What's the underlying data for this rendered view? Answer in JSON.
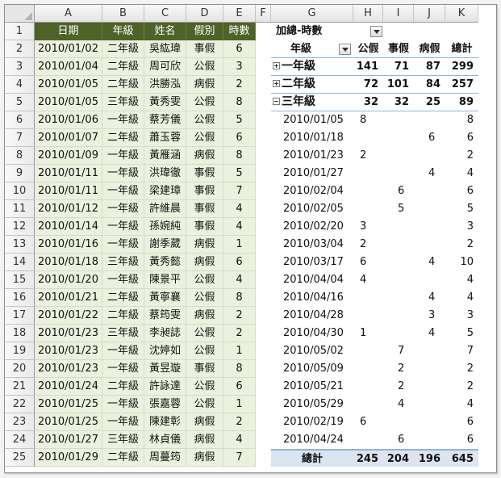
{
  "columns": [
    "A",
    "B",
    "C",
    "D",
    "E",
    "F",
    "G",
    "H",
    "I",
    "J",
    "K"
  ],
  "row_numbers": [
    "1",
    "2",
    "3",
    "4",
    "5",
    "6",
    "7",
    "8",
    "9",
    "10",
    "11",
    "12",
    "13",
    "14",
    "15",
    "16",
    "17",
    "18",
    "19",
    "20",
    "21",
    "22",
    "23",
    "24",
    "25"
  ],
  "source_table": {
    "headers": [
      "日期",
      "年級",
      "姓名",
      "假別",
      "時數"
    ],
    "rows": [
      [
        "2010/01/02",
        "二年級",
        "吳紘瑋",
        "事假",
        "6"
      ],
      [
        "2010/01/04",
        "二年級",
        "周可欣",
        "公假",
        "3"
      ],
      [
        "2010/01/05",
        "二年級",
        "洪勝泓",
        "病假",
        "2"
      ],
      [
        "2010/01/05",
        "三年級",
        "黃秀雯",
        "公假",
        "8"
      ],
      [
        "2010/01/06",
        "一年級",
        "蔡芳儀",
        "公假",
        "5"
      ],
      [
        "2010/01/07",
        "二年級",
        "蕭玉蓉",
        "公假",
        "6"
      ],
      [
        "2010/01/09",
        "一年級",
        "黃雁涵",
        "病假",
        "8"
      ],
      [
        "2010/01/11",
        "一年級",
        "洪瑋徹",
        "事假",
        "5"
      ],
      [
        "2010/01/11",
        "一年級",
        "梁建璋",
        "事假",
        "7"
      ],
      [
        "2010/01/12",
        "一年級",
        "許維晨",
        "事假",
        "4"
      ],
      [
        "2010/01/14",
        "一年級",
        "孫婉純",
        "事假",
        "4"
      ],
      [
        "2010/01/16",
        "一年級",
        "謝季葳",
        "病假",
        "1"
      ],
      [
        "2010/01/18",
        "三年級",
        "黃秀懿",
        "病假",
        "6"
      ],
      [
        "2010/01/20",
        "一年級",
        "陳景平",
        "公假",
        "4"
      ],
      [
        "2010/01/21",
        "二年級",
        "黃寧襄",
        "公假",
        "8"
      ],
      [
        "2010/01/22",
        "二年級",
        "蔡筠雯",
        "病假",
        "2"
      ],
      [
        "2010/01/23",
        "三年級",
        "李昶誌",
        "公假",
        "2"
      ],
      [
        "2010/01/23",
        "一年級",
        "沈婷如",
        "公假",
        "1"
      ],
      [
        "2010/01/23",
        "一年級",
        "黃昱璇",
        "事假",
        "8"
      ],
      [
        "2010/01/24",
        "二年級",
        "許詠達",
        "公假",
        "6"
      ],
      [
        "2010/01/25",
        "一年級",
        "張嘉蓉",
        "公假",
        "1"
      ],
      [
        "2010/01/25",
        "一年級",
        "陳建彰",
        "病假",
        "2"
      ],
      [
        "2010/01/27",
        "三年級",
        "林貞儀",
        "病假",
        "4"
      ],
      [
        "2010/01/29",
        "二年級",
        "周蔓筠",
        "病假",
        "7"
      ]
    ]
  },
  "pivot": {
    "title": "加總-時數",
    "row_label": "年級",
    "col_headers": [
      "公假",
      "事假",
      "病假",
      "總計"
    ],
    "groups": [
      {
        "label": "一年級",
        "values": [
          "141",
          "71",
          "87",
          "299"
        ],
        "expanded": false
      },
      {
        "label": "二年級",
        "values": [
          "72",
          "101",
          "84",
          "257"
        ],
        "expanded": false
      },
      {
        "label": "三年級",
        "values": [
          "32",
          "32",
          "25",
          "89"
        ],
        "expanded": true
      }
    ],
    "details": [
      {
        "date": "2010/01/05",
        "values": [
          "8",
          "",
          "",
          "8"
        ]
      },
      {
        "date": "2010/01/18",
        "values": [
          "",
          "",
          "6",
          "6"
        ]
      },
      {
        "date": "2010/01/23",
        "values": [
          "2",
          "",
          "",
          "2"
        ]
      },
      {
        "date": "2010/01/27",
        "values": [
          "",
          "",
          "4",
          "4"
        ]
      },
      {
        "date": "2010/02/04",
        "values": [
          "",
          "6",
          "",
          "6"
        ]
      },
      {
        "date": "2010/02/05",
        "values": [
          "",
          "5",
          "",
          "5"
        ]
      },
      {
        "date": "2010/02/20",
        "values": [
          "3",
          "",
          "",
          "3"
        ]
      },
      {
        "date": "2010/03/04",
        "values": [
          "2",
          "",
          "",
          "2"
        ]
      },
      {
        "date": "2010/03/17",
        "values": [
          "6",
          "",
          "4",
          "10"
        ]
      },
      {
        "date": "2010/04/04",
        "values": [
          "4",
          "",
          "",
          "4"
        ]
      },
      {
        "date": "2010/04/16",
        "values": [
          "",
          "",
          "4",
          "4"
        ]
      },
      {
        "date": "2010/04/28",
        "values": [
          "",
          "",
          "3",
          "3"
        ]
      },
      {
        "date": "2010/04/30",
        "values": [
          "1",
          "",
          "4",
          "5"
        ]
      },
      {
        "date": "2010/05/02",
        "values": [
          "",
          "7",
          "",
          "7"
        ]
      },
      {
        "date": "2010/05/09",
        "values": [
          "",
          "2",
          "",
          "2"
        ]
      },
      {
        "date": "2010/05/21",
        "values": [
          "",
          "2",
          "",
          "2"
        ]
      },
      {
        "date": "2010/05/29",
        "values": [
          "",
          "4",
          "",
          "4"
        ]
      },
      {
        "date": "2010/02/19",
        "values": [
          "6",
          "",
          "",
          "6"
        ]
      },
      {
        "date": "2010/04/24",
        "values": [
          "",
          "6",
          "",
          "6"
        ]
      }
    ],
    "grand_total_label": "總計",
    "grand_total_values": [
      "245",
      "204",
      "196",
      "645"
    ]
  }
}
